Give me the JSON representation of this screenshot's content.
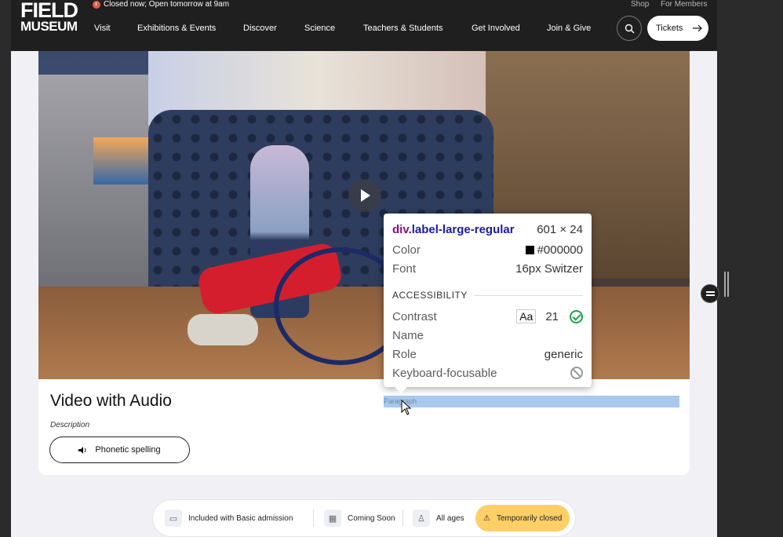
{
  "header": {
    "logo_line1": "FIELD",
    "logo_line2": "MUSEUM",
    "status": "Closed now; Open tomorrow at 9am",
    "util_links": [
      "Shop",
      "For Members"
    ],
    "nav": [
      "Visit",
      "Exhibitions & Events",
      "Discover",
      "Science",
      "Teachers & Students",
      "Get Involved",
      "Join & Give"
    ],
    "tickets_label": "Tickets"
  },
  "media": {
    "title": "Video with Audio",
    "description": "Description",
    "phonetic_label": "Phonetic spelling",
    "paragraph_placeholder": "Paragraph"
  },
  "info_chips": [
    {
      "label": "Included with Basic admission",
      "icon": "ticket-icon"
    },
    {
      "label": "Coming Soon",
      "icon": "calendar-icon"
    },
    {
      "label": "All ages",
      "icon": "person-icon"
    },
    {
      "label": "Temporarily closed",
      "icon": "warning-icon"
    }
  ],
  "inspector": {
    "tag": "div",
    "class": ".label-large-regular",
    "dimensions": "601 × 24",
    "color_label": "Color",
    "color_value": "#000000",
    "font_label": "Font",
    "font_value": "16px Switzer",
    "section": "ACCESSIBILITY",
    "contrast_label": "Contrast",
    "contrast_aa": "Aa",
    "contrast_value": "21",
    "name_label": "Name",
    "role_label": "Role",
    "role_value": "generic",
    "focus_label": "Keyboard-focusable"
  },
  "colors": {
    "header_bg": "#1f1f1f",
    "closed_chip": "#fdcf66",
    "highlight": "#a8c8ec"
  }
}
